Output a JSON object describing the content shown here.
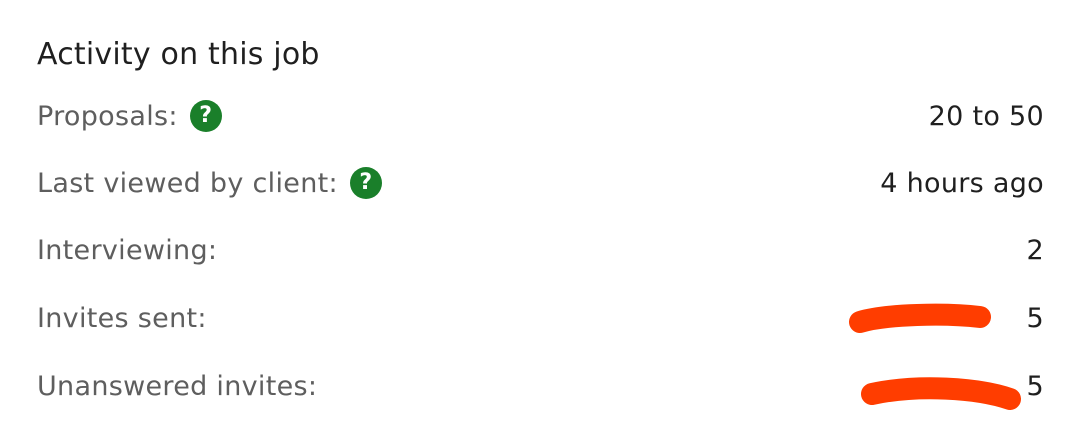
{
  "panel": {
    "title": "Activity on this job",
    "rows": [
      {
        "label": "Proposals:",
        "value": "20 to 50",
        "help_icon": "help-circle-icon"
      },
      {
        "label": "Last viewed by client:",
        "value": "4 hours ago",
        "help_icon": "help-circle-icon"
      },
      {
        "label": "Interviewing:",
        "value": "2"
      },
      {
        "label": "Invites sent:",
        "value": "5"
      },
      {
        "label": "Unanswered invites:",
        "value": "5"
      }
    ],
    "help_icon_glyph": "?"
  },
  "colors": {
    "help_icon": "#1a7f2a",
    "redaction_mark": "#ff3d00"
  }
}
